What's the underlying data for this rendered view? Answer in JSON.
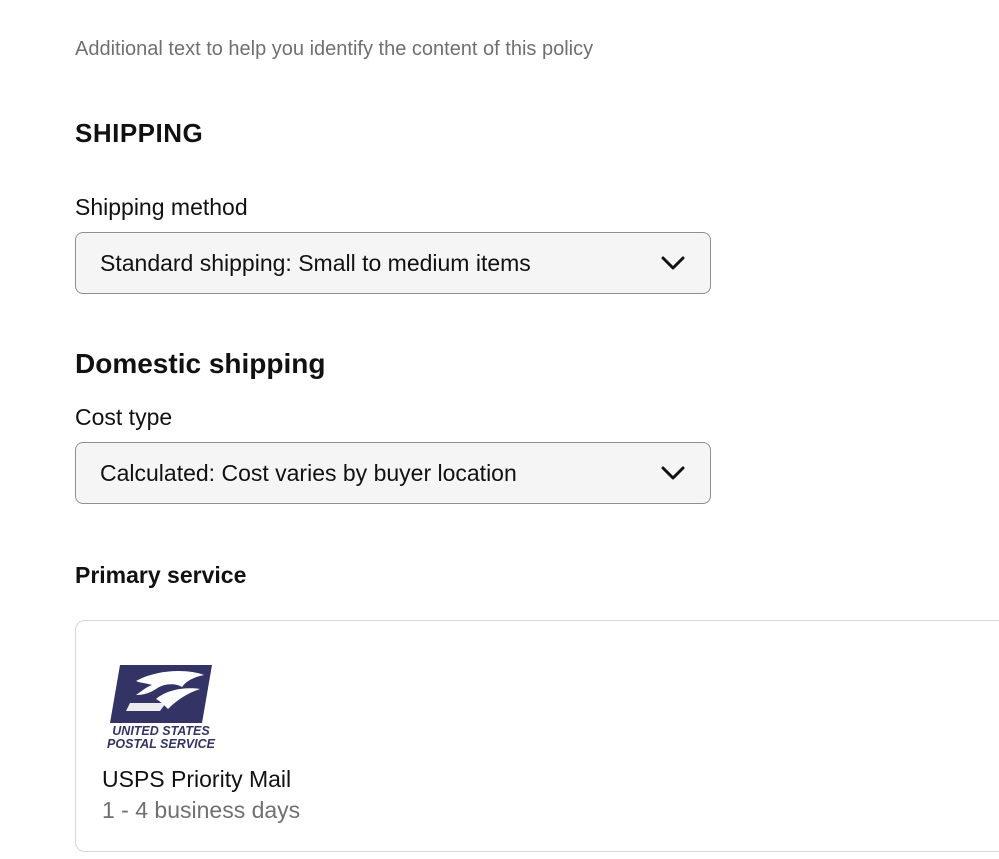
{
  "helper_text": "Additional text to help you identify the content of this policy",
  "shipping": {
    "heading": "SHIPPING",
    "method_label": "Shipping method",
    "method_value": "Standard shipping: Small to medium items"
  },
  "domestic": {
    "heading": "Domestic shipping",
    "cost_type_label": "Cost type",
    "cost_type_value": "Calculated: Cost varies by buyer location"
  },
  "primary_service": {
    "heading": "Primary service",
    "logo_line1": "UNITED STATES",
    "logo_line2": "POSTAL SERVICE",
    "name": "USPS Priority Mail",
    "delivery_time": "1 - 4 business days"
  },
  "colors": {
    "usps_blue": "#333366",
    "muted_text": "#707070",
    "select_bg": "#f5f5f5"
  },
  "icons": {
    "select_chevron": "chevron-down-icon",
    "carrier_logo": "usps-eagle-logo"
  }
}
